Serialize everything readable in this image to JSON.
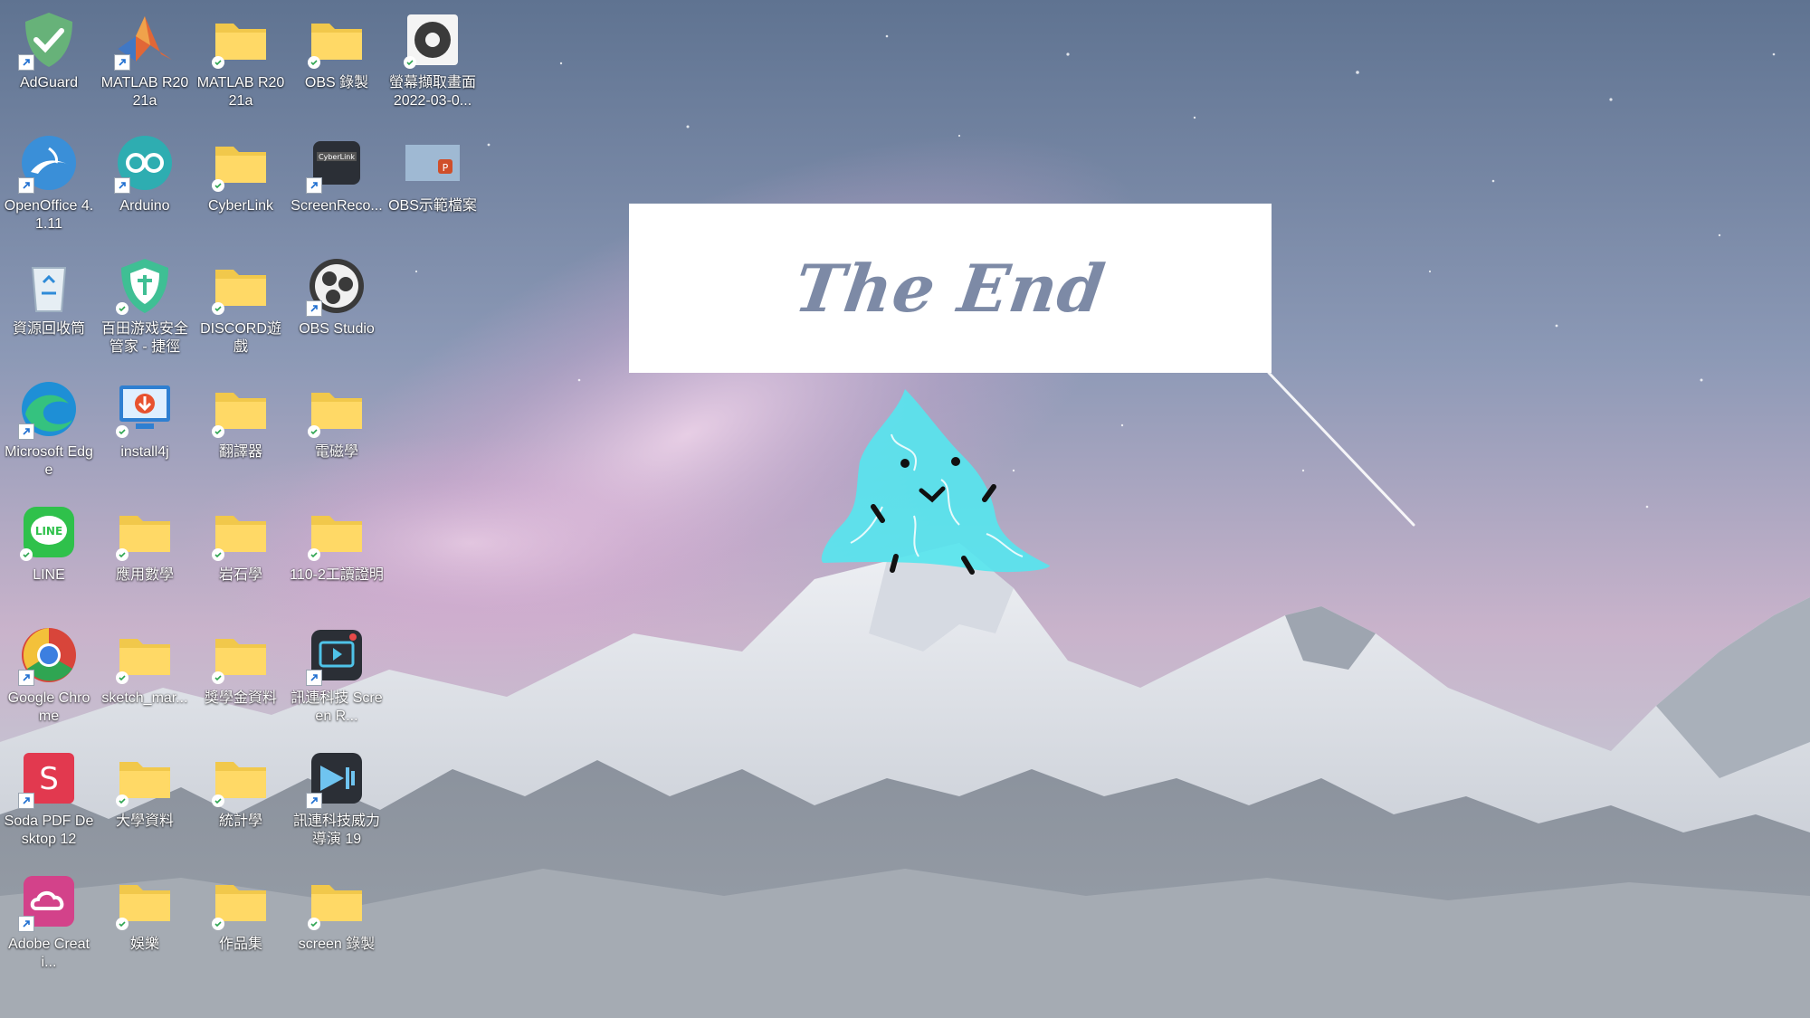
{
  "banner": {
    "title": "The End"
  },
  "icons": [
    {
      "label": "AdGuard",
      "icon": "adguard-shield-icon"
    },
    {
      "label": "MATLAB R2021a",
      "icon": "matlab-icon"
    },
    {
      "label": "MATLAB R2021a",
      "icon": "folder-icon"
    },
    {
      "label": "OBS 錄製",
      "icon": "folder-icon"
    },
    {
      "label": "螢幕擷取畫面 2022-03-0...",
      "icon": "screenshot-file-icon"
    },
    {
      "label": "OpenOffice 4.1.11",
      "icon": "openoffice-icon"
    },
    {
      "label": "Arduino",
      "icon": "arduino-icon"
    },
    {
      "label": "CyberLink",
      "icon": "folder-icon"
    },
    {
      "label": "ScreenReco...",
      "icon": "cyberlink-screenrecorder-icon"
    },
    {
      "label": "OBS示範檔案",
      "icon": "powerpoint-file-icon"
    },
    {
      "label": "資源回收筒",
      "icon": "recycle-bin-icon"
    },
    {
      "label": "百田游戏安全管家 - 捷徑",
      "icon": "security-shield-icon"
    },
    {
      "label": "DISCORD遊戲",
      "icon": "folder-icon"
    },
    {
      "label": "OBS Studio",
      "icon": "obs-studio-icon"
    },
    {
      "label": "Microsoft Edge",
      "icon": "edge-icon"
    },
    {
      "label": "install4j",
      "icon": "install4j-icon"
    },
    {
      "label": "翻譯器",
      "icon": "folder-icon"
    },
    {
      "label": "電磁學",
      "icon": "folder-icon"
    },
    {
      "label": "LINE",
      "icon": "line-icon"
    },
    {
      "label": "應用數學",
      "icon": "folder-icon"
    },
    {
      "label": "岩石學",
      "icon": "folder-icon"
    },
    {
      "label": "110-2工讀證明",
      "icon": "folder-icon"
    },
    {
      "label": "Google Chrome",
      "icon": "chrome-icon"
    },
    {
      "label": "sketch_mar...",
      "icon": "folder-icon"
    },
    {
      "label": "獎學金資料",
      "icon": "folder-icon"
    },
    {
      "label": "訊連科技 Screen R...",
      "icon": "cyberlink-screen-recorder-app-icon"
    },
    {
      "label": "Soda PDF Desktop 12",
      "icon": "soda-pdf-icon"
    },
    {
      "label": "大學資料",
      "icon": "folder-icon"
    },
    {
      "label": "統計學",
      "icon": "folder-icon"
    },
    {
      "label": "訊連科技威力導演 19",
      "icon": "powerdirector-icon"
    },
    {
      "label": "Adobe Creati...",
      "icon": "adobe-creative-cloud-icon"
    },
    {
      "label": "娛樂",
      "icon": "folder-icon"
    },
    {
      "label": "作品集",
      "icon": "folder-icon"
    },
    {
      "label": "screen 錄製",
      "icon": "folder-icon"
    }
  ]
}
